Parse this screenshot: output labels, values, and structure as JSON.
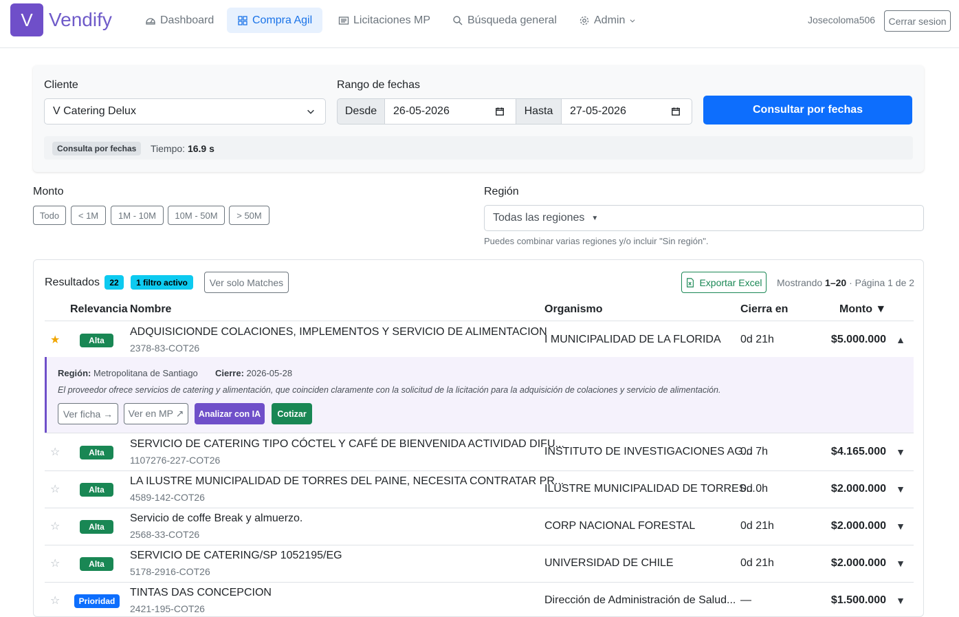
{
  "app": {
    "logo_letter": "V",
    "name": "Vendify"
  },
  "nav": {
    "items": [
      {
        "label": "Dashboard",
        "icon": "dashboard-icon"
      },
      {
        "label": "Compra Agil",
        "icon": "grid-icon",
        "active": true
      },
      {
        "label": "Licitaciones MP",
        "icon": "list-icon"
      },
      {
        "label": "Búsqueda general",
        "icon": "search-icon"
      },
      {
        "label": "Admin",
        "icon": "gear-icon"
      }
    ],
    "user": "Josecoloma506",
    "logout": "Cerrar sesion"
  },
  "filters": {
    "cliente_label": "Cliente",
    "cliente_value": "V Catering Delux",
    "rango_label": "Rango de fechas",
    "desde_label": "Desde",
    "desde_value": "26-05-2026",
    "hasta_label": "Hasta",
    "hasta_value": "27-05-2026",
    "consultar": "Consultar por fechas",
    "mode_badge": "Consulta por fechas",
    "tiempo_label": "Tiempo:",
    "tiempo_value": "16.9 s",
    "monto_label": "Monto",
    "monto_options": [
      "Todo",
      "< 1M",
      "1M - 10M",
      "10M - 50M",
      "> 50M"
    ],
    "region_label": "Región",
    "region_value": "Todas las regiones",
    "region_help": "Puedes combinar varias regiones y/o incluir \"Sin región\"."
  },
  "results": {
    "title": "Resultados",
    "count": "22",
    "filter_badge": "1 filtro activo",
    "matches_btn": "Ver solo Matches",
    "export": "Exportar Excel",
    "showing_prefix": "Mostrando",
    "showing_range": "1–20",
    "showing_suffix": "· Página 1 de 2",
    "columns": {
      "relevancia": "Relevancia",
      "nombre": "Nombre",
      "organismo": "Organismo",
      "cierra": "Cierra en",
      "monto": "Monto ▼"
    },
    "rows": [
      {
        "star": "★",
        "starred": true,
        "relevance": "Alta",
        "name": "ADQUISICIONDE COLACIONES, IMPLEMENTOS Y SERVICIO DE ALIMENTACION",
        "code": "2378-83-COT26",
        "org": "I MUNICIPALIDAD DE LA FLORIDA",
        "close": "0d 21h",
        "amount": "$5.000.000",
        "toggle": "▲"
      },
      {
        "star": "☆",
        "relevance": "Alta",
        "name": "SERVICIO DE CATERING TIPO CÓCTEL Y CAFÉ DE BIENVENIDA ACTIVIDAD DIFU...",
        "code": "1107276-227-COT26",
        "org": "INSTITUTO DE INVESTIGACIONES AG...",
        "close": "0d 7h",
        "amount": "$4.165.000",
        "toggle": "▼"
      },
      {
        "star": "☆",
        "relevance": "Alta",
        "name": "LA ILUSTRE MUNICIPALIDAD DE TORRES DEL PAINE, NECESITA CONTRATAR PR...",
        "code": "4589-142-COT26",
        "org": "ILUSTRE MUNICIPALIDAD DE TORRES...",
        "close": "0d 0h",
        "amount": "$2.000.000",
        "toggle": "▼"
      },
      {
        "star": "☆",
        "relevance": "Alta",
        "name": "Servicio de coffe Break y almuerzo.",
        "code": "2568-33-COT26",
        "org": "CORP NACIONAL FORESTAL",
        "close": "0d 21h",
        "amount": "$2.000.000",
        "toggle": "▼"
      },
      {
        "star": "☆",
        "relevance": "Alta",
        "name": "SERVICIO DE CATERING/SP 1052195/EG",
        "code": "5178-2916-COT26",
        "org": "UNIVERSIDAD DE CHILE",
        "close": "0d 21h",
        "amount": "$2.000.000",
        "toggle": "▼"
      },
      {
        "star": "☆",
        "relevance": "Prioridad",
        "name": "TINTAS DAS CONCEPCION",
        "code": "2421-195-COT26",
        "org": "Dirección de Administración de Salud...",
        "close": "—",
        "amount": "$1.500.000",
        "toggle": "▼"
      }
    ],
    "detail": {
      "region_label": "Región:",
      "region_value": "Metropolitana de Santiago",
      "cierre_label": "Cierre:",
      "cierre_value": "2026-05-28",
      "description": "El proveedor ofrece servicios de catering y alimentación, que coinciden claramente con la solicitud de la licitación para la adquisición de colaciones y servicio de alimentación.",
      "ver_ficha": "Ver ficha →",
      "ver_mp": "Ver en MP ↗",
      "analizar": "Analizar con IA",
      "cotizar": "Cotizar"
    }
  },
  "colors": {
    "brand": "#6f4fc9",
    "primary": "#0d6efd",
    "success": "#198754",
    "info": "#0dcaf0",
    "star": "#f0a500"
  }
}
